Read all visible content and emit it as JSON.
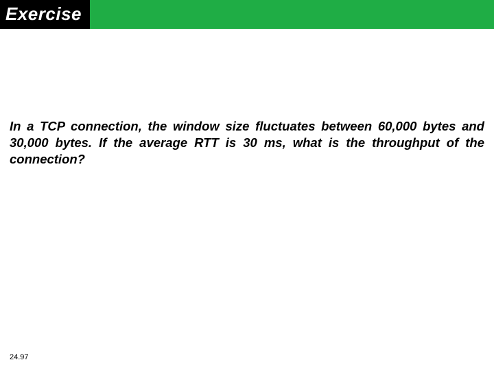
{
  "header": {
    "title": "Exercise"
  },
  "body": {
    "question": "In a TCP connection, the window size fluctuates between 60,000 bytes and 30,000 bytes. If the average RTT is 30 ms, what is the throughput of the connection?"
  },
  "footer": {
    "page_number": "24.97"
  },
  "colors": {
    "header_bg": "#1fad45",
    "tab_bg": "#000000",
    "tab_fg": "#ffffff"
  }
}
